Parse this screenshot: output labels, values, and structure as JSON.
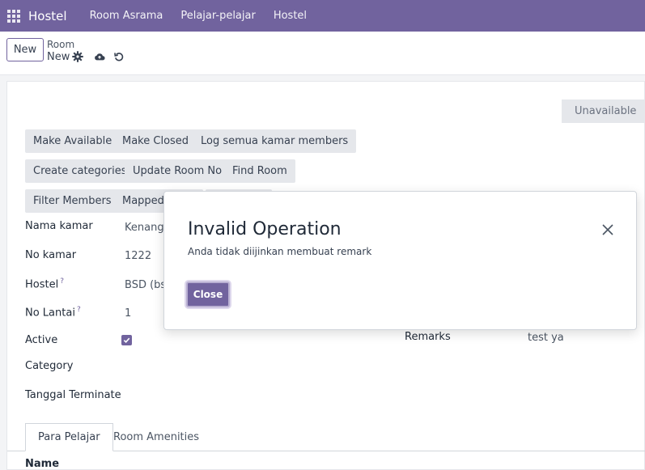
{
  "navbar": {
    "app_name": "Hostel",
    "menus": [
      "Room Asrama",
      "Pelajar-pelajar",
      "Hostel"
    ],
    "color": "#71639e"
  },
  "control_panel": {
    "new_label": "New",
    "breadcrumb_parent": "Room",
    "breadcrumb_current": "New",
    "icons": [
      "gear-icon",
      "cloud-upload-icon",
      "undo-icon"
    ]
  },
  "status": {
    "label": "Unavailable"
  },
  "actions": {
    "row1": [
      "Make Available",
      "Make Closed",
      "Log semua kamar members"
    ],
    "row2": [
      "Create categories",
      "Update Room No",
      "Find Room"
    ],
    "row3": [
      "Filter Members",
      "Mapped"
    ]
  },
  "fields": {
    "nama_kamar": {
      "label": "Nama kamar",
      "value": "Kenanga"
    },
    "no_kamar": {
      "label": "No kamar",
      "value": "1222"
    },
    "hostel": {
      "label": "Hostel",
      "help": "?",
      "value": "BSD (bsd"
    },
    "no_lantai": {
      "label": "No Lantai",
      "help": "?",
      "value": "1"
    },
    "active": {
      "label": "Active",
      "checked": true
    },
    "category": {
      "label": "Category"
    },
    "tanggal_terminate": {
      "label": "Tanggal Terminate"
    },
    "remarks": {
      "label": "Remarks",
      "value": "test ya"
    }
  },
  "tabs": [
    "Para Pelajar",
    "Room Amenities"
  ],
  "list": {
    "column_name": "Name"
  },
  "dialog": {
    "title": "Invalid Operation",
    "message": "Anda tidak diijinkan membuat remark",
    "close_label": "Close"
  }
}
